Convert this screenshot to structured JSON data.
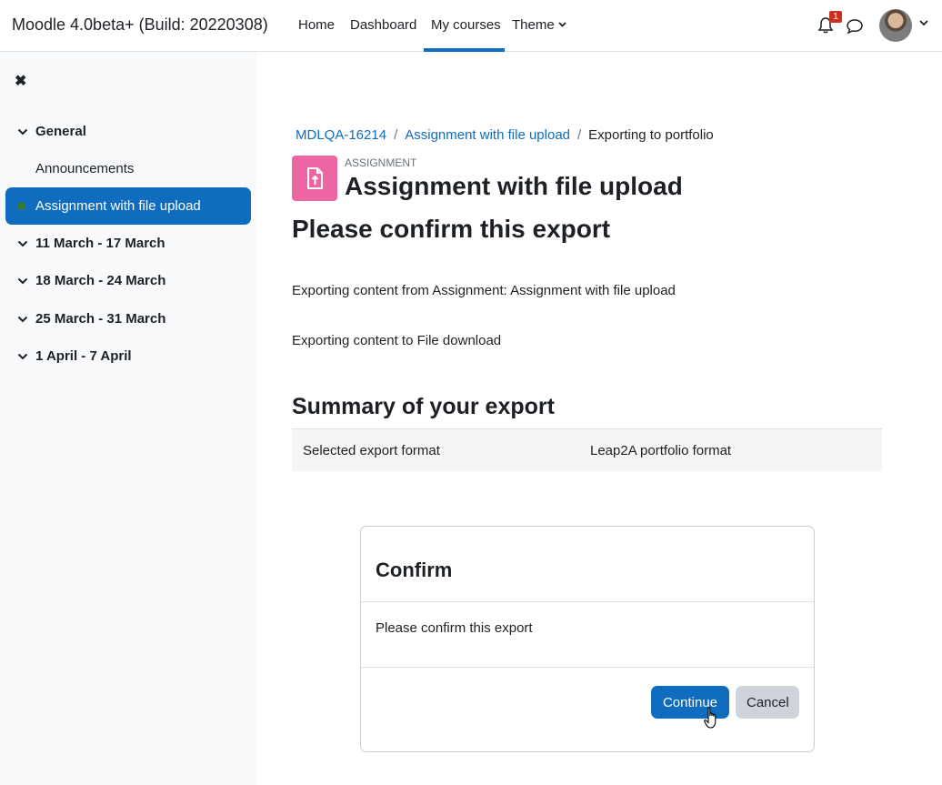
{
  "navbar": {
    "site_name": "Moodle 4.0beta+ (Build: 20220308)",
    "items": [
      {
        "label": "Home"
      },
      {
        "label": "Dashboard"
      },
      {
        "label": "My courses",
        "active": true
      },
      {
        "label": "Theme"
      }
    ],
    "notification_count": "1",
    "accent_color": "#0f6cbf"
  },
  "sidebar": {
    "close_icon": "close-icon",
    "sections": [
      {
        "label": "General",
        "activities": [
          {
            "label": "Announcements"
          },
          {
            "label": "Assignment with file upload",
            "active": true
          }
        ]
      },
      {
        "label": "11 March - 17 March"
      },
      {
        "label": "18 March - 24 March"
      },
      {
        "label": "25 March - 31 March"
      },
      {
        "label": "1 April - 7 April"
      }
    ]
  },
  "breadcrumb": [
    "MDLQA-16214",
    "Assignment with file upload",
    "Exporting to portfolio"
  ],
  "activity": {
    "type": "ASSIGNMENT",
    "title": "Assignment with file upload",
    "icon": "file-upload-icon",
    "icon_color": "#eb66a2"
  },
  "main": {
    "heading": "Please confirm this export",
    "line1": "Exporting content from Assignment: Assignment with file upload",
    "line2": "Exporting content to File download",
    "summary_heading": "Summary of your export",
    "summary_rows": [
      {
        "label": "Selected export format",
        "value": "Leap2A portfolio format"
      }
    ]
  },
  "confirm": {
    "title": "Confirm",
    "message": "Please confirm this export",
    "continue_label": "Continue",
    "cancel_label": "Cancel"
  }
}
